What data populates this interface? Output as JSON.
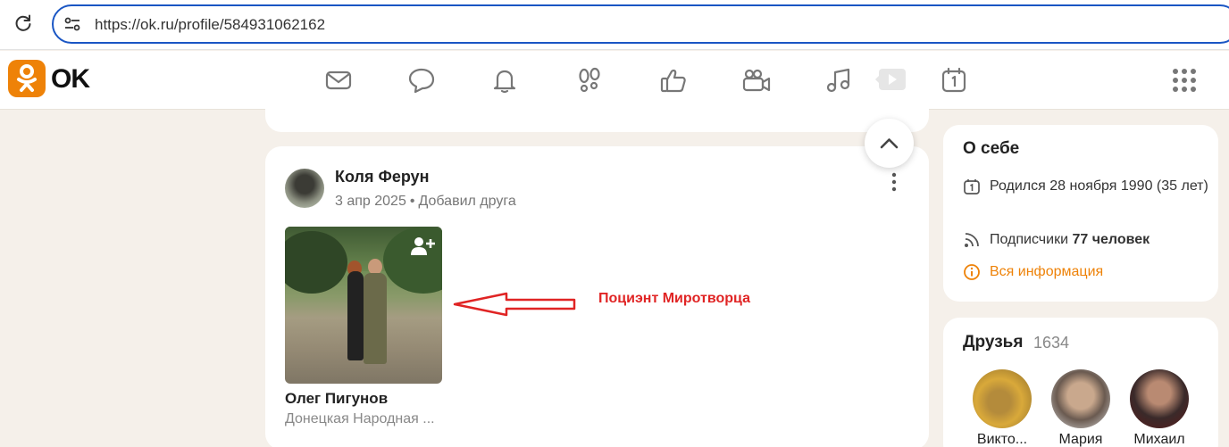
{
  "browser": {
    "url": "https://ok.ru/profile/584931062162"
  },
  "header": {
    "logo_text": "OK",
    "nav_icons": [
      "mail-icon",
      "chat-icon",
      "bell-icon",
      "footprints-icon",
      "like-icon",
      "video-camera-icon",
      "music-icon",
      "video-play-icon",
      "calendar-icon"
    ],
    "apps_icon": "apps-grid-icon",
    "brand_color": "#ee8208"
  },
  "post": {
    "author_name": "Коля Ферун",
    "date": "3 апр 2025",
    "meta_separator": "•",
    "action": "Добавил друга",
    "friend": {
      "name": "Олег Пигунов",
      "location": "Донецкая Народная ..."
    },
    "annotation": "Поциэнт Миротворца",
    "annotation_color": "#e02424"
  },
  "about": {
    "title": "О себе",
    "birth": "Родился 28 ноября 1990 (35 лет)",
    "subscribers_label": "Подписчики",
    "subscribers_value": "77 человек",
    "all_info": "Вся информация"
  },
  "friends": {
    "title": "Друзья",
    "count": "1634",
    "items": [
      {
        "name": "Викто..."
      },
      {
        "name": "Мария"
      },
      {
        "name": "Михаил"
      }
    ]
  }
}
